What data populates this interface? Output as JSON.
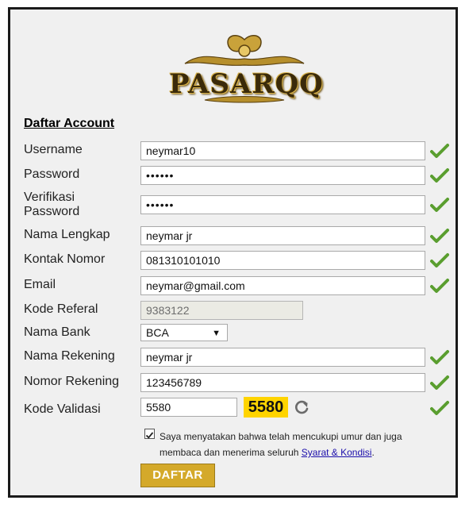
{
  "logo": {
    "text": "PASARQQ"
  },
  "form": {
    "title": "Daftar Account",
    "fields": [
      {
        "label": "Username",
        "value": "neymar10"
      },
      {
        "label": "Password",
        "value": "••••••"
      },
      {
        "label": "Verifikasi Password",
        "value": "••••••"
      },
      {
        "label": "Nama Lengkap",
        "value": "neymar jr"
      },
      {
        "label": "Kontak Nomor",
        "value": "081310101010"
      },
      {
        "label": "Email",
        "value": "neymar@gmail.com"
      },
      {
        "label": "Kode Referal",
        "value": "9383122"
      },
      {
        "label": "Nama Bank",
        "value": "BCA"
      },
      {
        "label": "Nama Rekening",
        "value": "neymar jr"
      },
      {
        "label": "Nomor Rekening",
        "value": "123456789"
      },
      {
        "label": "Kode Validasi",
        "value": "5580"
      }
    ],
    "captcha": "5580",
    "agreement": {
      "text": "Saya menyatakan bahwa telah mencukupi umur dan juga membaca dan menerima seluruh",
      "link": "Syarat & Kondisi",
      "suffix": ".",
      "checked": true
    },
    "submit_label": "DAFTAR"
  },
  "colors": {
    "check": "#5a9e2f",
    "captcha_bg": "#ffd400",
    "submit_bg": "#d4a92a"
  },
  "icons": {
    "valid": "checkmark-icon",
    "refresh": "refresh-icon"
  }
}
